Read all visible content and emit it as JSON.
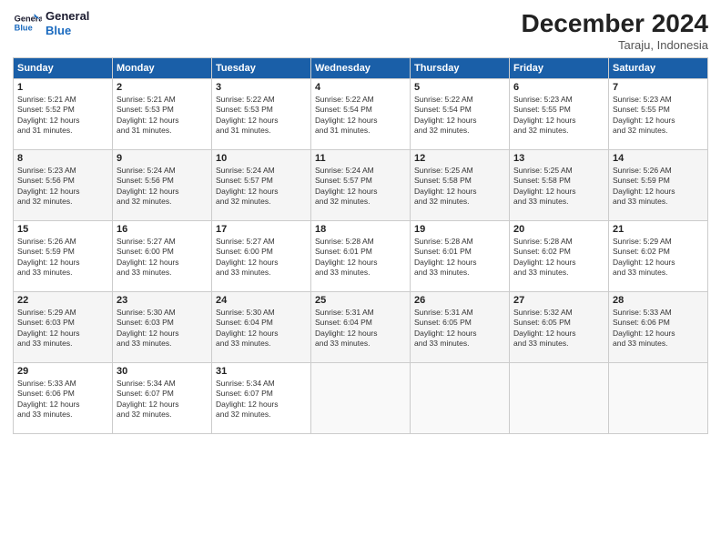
{
  "header": {
    "logo_line1": "General",
    "logo_line2": "Blue",
    "month": "December 2024",
    "location": "Taraju, Indonesia"
  },
  "weekdays": [
    "Sunday",
    "Monday",
    "Tuesday",
    "Wednesday",
    "Thursday",
    "Friday",
    "Saturday"
  ],
  "weeks": [
    [
      {
        "day": "1",
        "sunrise": "5:21 AM",
        "sunset": "5:52 PM",
        "daylight": "12 hours and 31 minutes."
      },
      {
        "day": "2",
        "sunrise": "5:21 AM",
        "sunset": "5:53 PM",
        "daylight": "12 hours and 31 minutes."
      },
      {
        "day": "3",
        "sunrise": "5:22 AM",
        "sunset": "5:53 PM",
        "daylight": "12 hours and 31 minutes."
      },
      {
        "day": "4",
        "sunrise": "5:22 AM",
        "sunset": "5:54 PM",
        "daylight": "12 hours and 31 minutes."
      },
      {
        "day": "5",
        "sunrise": "5:22 AM",
        "sunset": "5:54 PM",
        "daylight": "12 hours and 32 minutes."
      },
      {
        "day": "6",
        "sunrise": "5:23 AM",
        "sunset": "5:55 PM",
        "daylight": "12 hours and 32 minutes."
      },
      {
        "day": "7",
        "sunrise": "5:23 AM",
        "sunset": "5:55 PM",
        "daylight": "12 hours and 32 minutes."
      }
    ],
    [
      {
        "day": "8",
        "sunrise": "5:23 AM",
        "sunset": "5:56 PM",
        "daylight": "12 hours and 32 minutes."
      },
      {
        "day": "9",
        "sunrise": "5:24 AM",
        "sunset": "5:56 PM",
        "daylight": "12 hours and 32 minutes."
      },
      {
        "day": "10",
        "sunrise": "5:24 AM",
        "sunset": "5:57 PM",
        "daylight": "12 hours and 32 minutes."
      },
      {
        "day": "11",
        "sunrise": "5:24 AM",
        "sunset": "5:57 PM",
        "daylight": "12 hours and 32 minutes."
      },
      {
        "day": "12",
        "sunrise": "5:25 AM",
        "sunset": "5:58 PM",
        "daylight": "12 hours and 32 minutes."
      },
      {
        "day": "13",
        "sunrise": "5:25 AM",
        "sunset": "5:58 PM",
        "daylight": "12 hours and 33 minutes."
      },
      {
        "day": "14",
        "sunrise": "5:26 AM",
        "sunset": "5:59 PM",
        "daylight": "12 hours and 33 minutes."
      }
    ],
    [
      {
        "day": "15",
        "sunrise": "5:26 AM",
        "sunset": "5:59 PM",
        "daylight": "12 hours and 33 minutes."
      },
      {
        "day": "16",
        "sunrise": "5:27 AM",
        "sunset": "6:00 PM",
        "daylight": "12 hours and 33 minutes."
      },
      {
        "day": "17",
        "sunrise": "5:27 AM",
        "sunset": "6:00 PM",
        "daylight": "12 hours and 33 minutes."
      },
      {
        "day": "18",
        "sunrise": "5:28 AM",
        "sunset": "6:01 PM",
        "daylight": "12 hours and 33 minutes."
      },
      {
        "day": "19",
        "sunrise": "5:28 AM",
        "sunset": "6:01 PM",
        "daylight": "12 hours and 33 minutes."
      },
      {
        "day": "20",
        "sunrise": "5:28 AM",
        "sunset": "6:02 PM",
        "daylight": "12 hours and 33 minutes."
      },
      {
        "day": "21",
        "sunrise": "5:29 AM",
        "sunset": "6:02 PM",
        "daylight": "12 hours and 33 minutes."
      }
    ],
    [
      {
        "day": "22",
        "sunrise": "5:29 AM",
        "sunset": "6:03 PM",
        "daylight": "12 hours and 33 minutes."
      },
      {
        "day": "23",
        "sunrise": "5:30 AM",
        "sunset": "6:03 PM",
        "daylight": "12 hours and 33 minutes."
      },
      {
        "day": "24",
        "sunrise": "5:30 AM",
        "sunset": "6:04 PM",
        "daylight": "12 hours and 33 minutes."
      },
      {
        "day": "25",
        "sunrise": "5:31 AM",
        "sunset": "6:04 PM",
        "daylight": "12 hours and 33 minutes."
      },
      {
        "day": "26",
        "sunrise": "5:31 AM",
        "sunset": "6:05 PM",
        "daylight": "12 hours and 33 minutes."
      },
      {
        "day": "27",
        "sunrise": "5:32 AM",
        "sunset": "6:05 PM",
        "daylight": "12 hours and 33 minutes."
      },
      {
        "day": "28",
        "sunrise": "5:33 AM",
        "sunset": "6:06 PM",
        "daylight": "12 hours and 33 minutes."
      }
    ],
    [
      {
        "day": "29",
        "sunrise": "5:33 AM",
        "sunset": "6:06 PM",
        "daylight": "12 hours and 33 minutes."
      },
      {
        "day": "30",
        "sunrise": "5:34 AM",
        "sunset": "6:07 PM",
        "daylight": "12 hours and 32 minutes."
      },
      {
        "day": "31",
        "sunrise": "5:34 AM",
        "sunset": "6:07 PM",
        "daylight": "12 hours and 32 minutes."
      },
      null,
      null,
      null,
      null
    ]
  ]
}
